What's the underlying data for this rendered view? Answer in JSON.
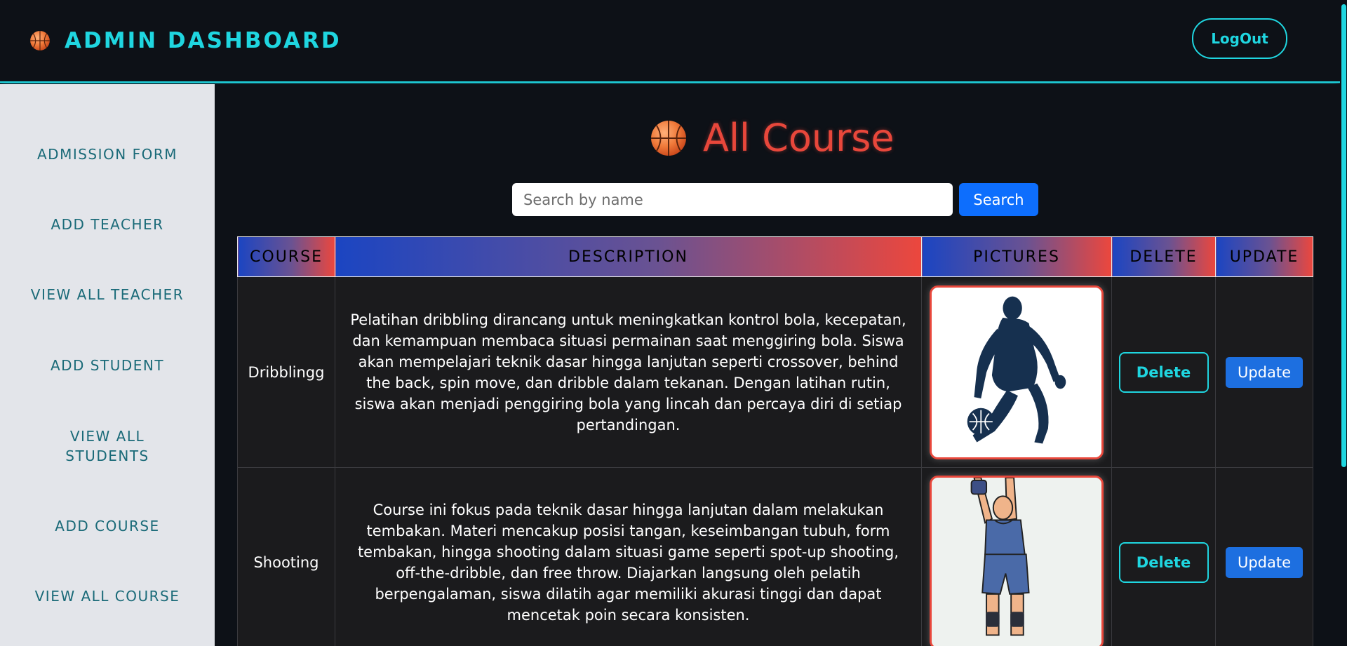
{
  "header": {
    "title": "ADMIN DASHBOARD",
    "logout_label": "LogOut"
  },
  "sidebar": {
    "items": [
      {
        "label": "ADMISSION FORM"
      },
      {
        "label": "ADD TEACHER"
      },
      {
        "label": "VIEW ALL TEACHER"
      },
      {
        "label": "ADD STUDENT"
      },
      {
        "label": "VIEW ALL STUDENTS"
      },
      {
        "label": "ADD COURSE"
      },
      {
        "label": "VIEW ALL COURSE"
      }
    ]
  },
  "main": {
    "title": "All Course",
    "search": {
      "placeholder": "Search by name",
      "value": "",
      "button_label": "Search"
    },
    "table": {
      "columns": [
        "COURSE",
        "DESCRIPTION",
        "PICTURES",
        "DELETE",
        "UPDATE"
      ],
      "rows": [
        {
          "course": "Dribblingg",
          "description": "Pelatihan dribbling dirancang untuk meningkatkan kontrol bola, kecepatan, dan kemampuan membaca situasi permainan saat menggiring bola. Siswa akan mempelajari teknik dasar hingga lanjutan seperti crossover, behind the back, spin move, dan dribble dalam tekanan. Dengan latihan rutin, siswa akan menjadi penggiring bola yang lincah dan percaya diri di setiap pertandingan.",
          "delete_label": "Delete",
          "update_label": "Update"
        },
        {
          "course": "Shooting",
          "description": "Course ini fokus pada teknik dasar hingga lanjutan dalam melakukan tembakan. Materi mencakup posisi tangan, keseimbangan tubuh, form tembakan, hingga shooting dalam situasi game seperti spot-up shooting, off-the-dribble, dan free throw. Diajarkan langsung oleh pelatih berpengalaman, siswa dilatih agar memiliki akurasi tinggi dan dapat mencetak poin secara konsisten.",
          "delete_label": "Delete",
          "update_label": "Update"
        }
      ]
    }
  },
  "colors": {
    "accent_cyan": "#1fd6e0",
    "title_red": "#e8473b",
    "primary_blue": "#0d6efd"
  },
  "icons": {
    "brand": "basketball-icon",
    "heading": "basketball-icon"
  }
}
